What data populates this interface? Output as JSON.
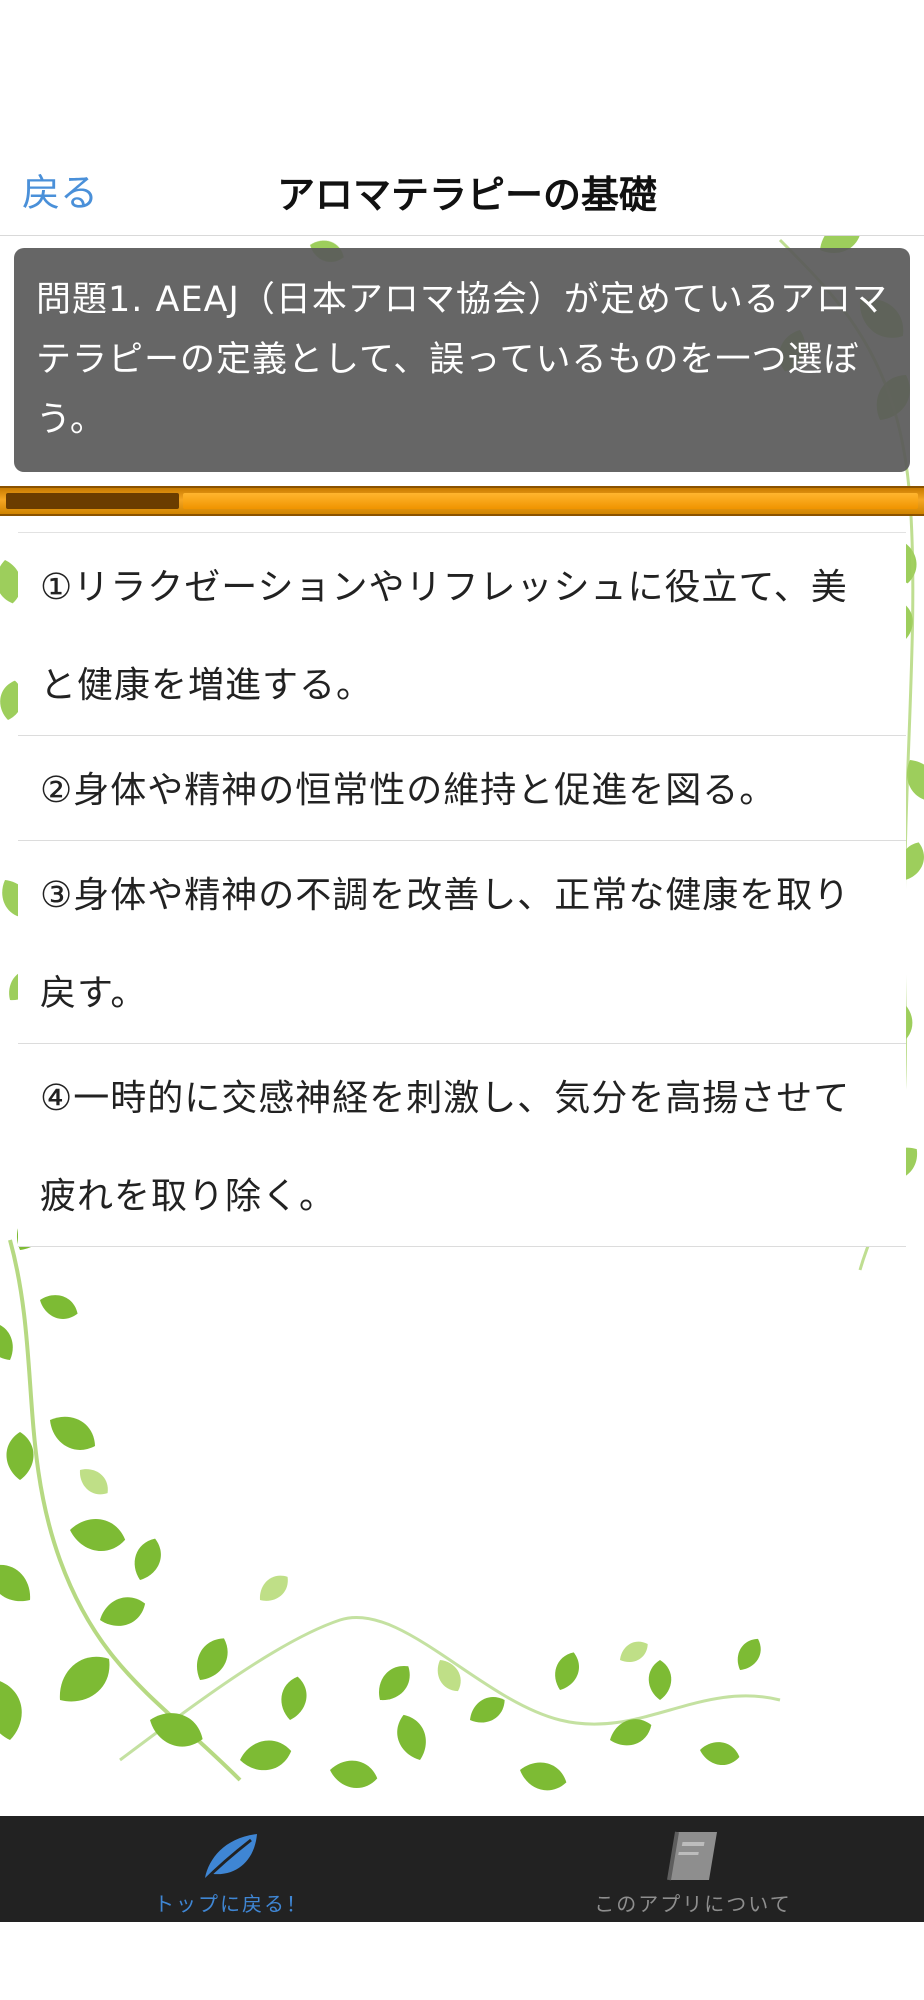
{
  "nav": {
    "back_label": "戻る",
    "title": "アロマテラピーの基礎"
  },
  "question": {
    "text": "問題1. AEAJ（日本アロマ協会）が定めているアロマテラピーの定義として、誤っているものを一つ選ぼう。"
  },
  "progress": {
    "fraction": 0.19,
    "fill_color": "#6b3d00",
    "bar_color": "#f5a623"
  },
  "answers": [
    {
      "label": "①リラクゼーションやリフレッシュに役立て、美と健康を増進する。"
    },
    {
      "label": "②身体や精神の恒常性の維持と促進を図る。"
    },
    {
      "label": "③身体や精神の不調を改善し、正常な健康を取り戻す。"
    },
    {
      "label": "④一時的に交感神経を刺激し、気分を高揚させて疲れを取り除く。"
    }
  ],
  "tabbar": {
    "tabs": [
      {
        "label": "トップに戻る！",
        "icon": "leaf-icon",
        "active": true,
        "color": "#3f86d4"
      },
      {
        "label": "このアプリについて",
        "icon": "book-icon",
        "active": false,
        "color": "#8e8e8e"
      }
    ]
  },
  "colors": {
    "accent": "#4a90d9",
    "question_bg": "#5a5a5a",
    "foliage": "#8cc63f"
  }
}
